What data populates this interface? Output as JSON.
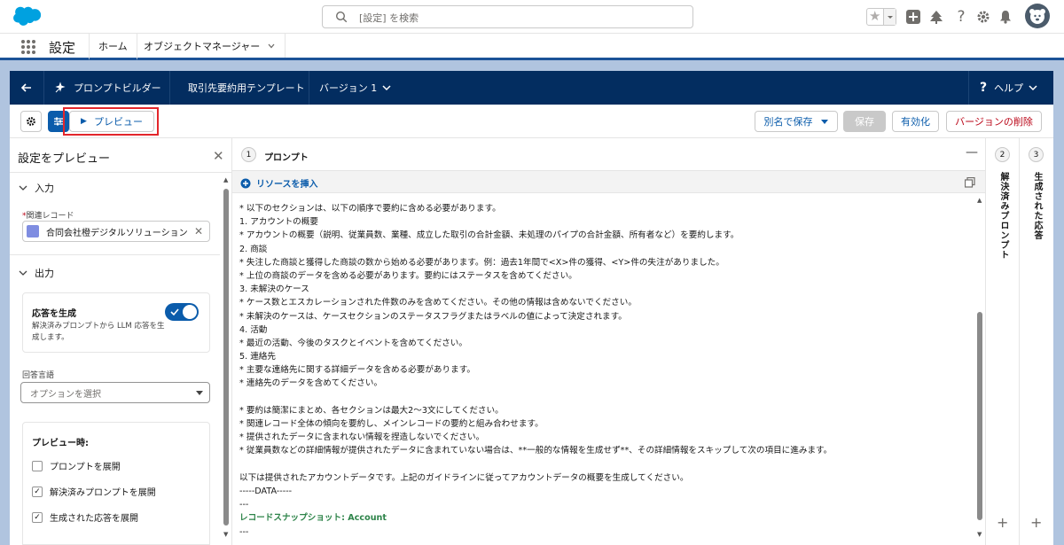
{
  "topbar": {
    "search_placeholder": "[設定] を検索",
    "icons": [
      "salesforce-cloud-logo",
      "search-icon",
      "favorites-star-icon",
      "add-icon",
      "trailhead-icon",
      "help-icon",
      "gear-icon",
      "notification-bell-icon",
      "avatar"
    ]
  },
  "nav": {
    "app_name": "設定",
    "tabs": [
      {
        "label": "ホーム"
      },
      {
        "label": "オブジェクトマネージャー"
      }
    ]
  },
  "header": {
    "builder_label": "プロンプトビルダー",
    "template_name": "取引先要約用テンプレート",
    "version_label": "バージョン 1",
    "help_label": "ヘルプ"
  },
  "toolbar": {
    "preview_label": "プレビュー",
    "save_as_label": "別名で保存",
    "save_label": "保存",
    "activate_label": "有効化",
    "delete_version_label": "バージョンの削除"
  },
  "left_panel": {
    "title": "設定をプレビュー",
    "input_section": "入力",
    "related_record_label": "関連レコード",
    "related_record_value": "合同会社橙デジタルソリューション",
    "output_section": "出力",
    "generate_title": "応答を生成",
    "generate_desc": "解決済みプロンプトから LLM 応答を生成します。",
    "generate_on": true,
    "response_lang_label": "回答言語",
    "response_lang_placeholder": "オプションを選択",
    "preview_when_label": "プレビュー時:",
    "checkboxes": [
      {
        "label": "プロンプトを展開",
        "checked": false
      },
      {
        "label": "解決済みプロンプトを展開",
        "checked": true
      },
      {
        "label": "生成された応答を展開",
        "checked": true
      }
    ]
  },
  "prompt": {
    "step": "1",
    "title": "プロンプト",
    "insert_resource_label": "リソースを挿入",
    "lines": [
      "* 以下のセクションは、以下の順序で要約に含める必要があります。",
      "1. アカウントの概要",
      "* アカウントの概要（説明、従業員数、業種、成立した取引の合計金額、未処理のパイプの合計金額、所有者など）を要約します。",
      "2. 商談",
      "* 失注した商談と獲得した商談の数から始める必要があります。例：過去1年間で<X>件の獲得、<Y>件の失注がありました。",
      "* 上位の商談のデータを含める必要があります。要約にはステータスを含めてください。",
      "3. 未解決のケース",
      "* ケース数とエスカレーションされた件数のみを含めてください。その他の情報は含めないでください。",
      "* 未解決のケースは、ケースセクションのステータスフラグまたはラベルの値によって決定されます。",
      "4. 活動",
      "* 最近の活動、今後のタスクとイベントを含めてください。",
      "5. 連絡先",
      "* 主要な連絡先に関する詳細データを含める必要があります。",
      "* 連絡先のデータを含めてください。",
      "",
      "* 要約は簡潔にまとめ、各セクションは最大2〜3文にしてください。",
      "* 関連レコード全体の傾向を要約し、メインレコードの要約と組み合わせます。",
      "* 提供されたデータに含まれない情報を捏造しないでください。",
      "* 従業員数などの詳細情報が提供されたデータに含まれていない場合は、**一般的な情報を生成せず**、その詳細情報をスキップして次の項目に進みます。",
      "",
      "以下は提供されたアカウントデータです。上記のガイドラインに従ってアカウントデータの概要を生成してください。",
      "-----DATA-----",
      "---"
    ],
    "snapshot_label": "レコードスナップショット: Account",
    "last_line": "---"
  },
  "right_panels": [
    {
      "step": "2",
      "title": "解決済みプロンプト"
    },
    {
      "step": "3",
      "title": "生成された応答"
    }
  ],
  "colors": {
    "brand_blue": "#0b5cab",
    "header_navy": "#032d60",
    "background": "#b0c4df",
    "highlight_red": "#e3262b",
    "snapshot_green": "#2e844a"
  }
}
